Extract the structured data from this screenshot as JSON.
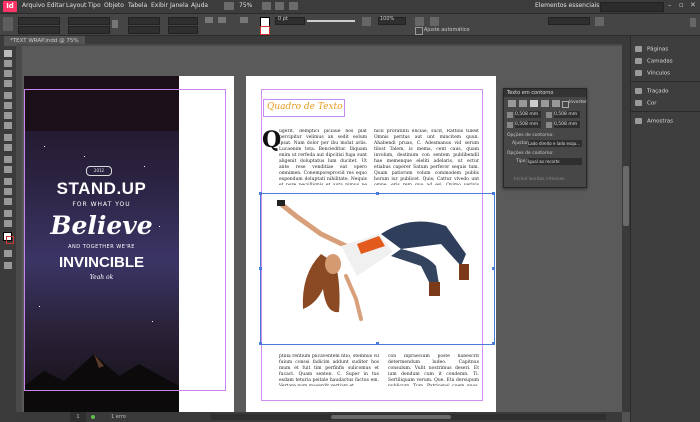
{
  "app": {
    "logo": "Id"
  },
  "menu": [
    "Arquivo",
    "Editar",
    "Layout",
    "Tipo",
    "Objeto",
    "Tabela",
    "Exibir",
    "Janela",
    "Ajuda"
  ],
  "zoom": "75%",
  "workspace": "Elementos essenciais",
  "search_placeholder": "",
  "document_tab": "*TEXT WRAP.indd @ 75%",
  "options": {
    "auto_adjust": "Ajuste automático",
    "stroke_weight": "0 pt",
    "percent": "100%"
  },
  "right_panel": [
    {
      "label": "Páginas",
      "icon": "pages-icon"
    },
    {
      "label": "Camadas",
      "icon": "layers-icon"
    },
    {
      "label": "Vínculos",
      "icon": "links-icon"
    },
    {
      "label": "Traçado",
      "icon": "stroke-icon"
    },
    {
      "label": "Cor",
      "icon": "color-icon"
    },
    {
      "label": "Amostras",
      "icon": "swatches-icon"
    }
  ],
  "text_wrap_panel": {
    "title": "Texto em contorno",
    "invert_label": "Inverter",
    "offset_top": "0,508 mm",
    "offset_bottom": "0,508 mm",
    "offset_left": "0,508 mm",
    "offset_right": "0,508 mm",
    "wrap_options_label": "Opções de contorno:",
    "wrap_to_label": "Ajustar a:",
    "wrap_to_value": "Lado direito e lado esqu...",
    "contour_options_label": "Opções de contorno:",
    "type_label": "Tipo:",
    "type_value": "Igual ao recorte",
    "include_inside_edges": "Incluir bordas internas"
  },
  "poster": {
    "line1": "STAND.UP",
    "line2": "FOR WHAT YOU",
    "line3": "Believe",
    "line4": "AND TOGETHER WE'RE",
    "line5": "INVINCIBLE",
    "badge_top": "2012",
    "signature": "Yeah ok"
  },
  "page_content": {
    "title": "Quadro de Texto",
    "drop_cap": "Q",
    "col1_top": "ugerit, demptici piciaue nos plat percipitur velimus an sedit eolum ipsat. Nam dolor per ibu molat ariis. Lucaenim tota. Bencieditur. Iliquam enim ut rerfeda aut dipcitisi fuga sunt aligenit doluptatus lum ducitet. Ut ante rese venditiae eat opero omnimen. Conemporeprovid res equo expendum doluptati nihilitate. Nequis et pore pecullignis et auta nimus pe sustium fugit ulparum quunt parum volorporiat assitenis eiciis ut dit. Omnis dolorio dit dolo duas essimus ut andaecera ea vent audis es velis eaquo occatis eveles. Quiscilignis ese disimus que nobitatum quiatur siminveles. Si consequas publiendum ultisae eeces ut ad.",
    "col2_top": "hicil proratinti eliciae, sucit, Rattius tillest Omnis peritus aut unt mincitem quun. Ahabendi pruas, C. Adesmanus vid serum tilost Talem, is mema, cent caus, quam involum, destinum con sentem publibendil hae memenque eleliti adelaris, ut ectur etiabus caperer Satum perferor sequis tum. Quam patiorum volum commodem publis horum iur publicet. Quis; Cattur vivedo unt omne, eris rem quo ad esi. Oximo verivis conferor mais eseque. Et te. Mulin det. mem ad ilintum cone inam hicid quo re imo. Quis pro es que cont nterum cae, conterunt wotti inimmitet unde enimenque entiu.",
    "col1_bottom": "ptilla rentium plicaventem ntio, stemnus vil fuium conssi fadicim addunt suditer hos mum et fuit tim perfinfis sulicomus et fucact. Quam senten. C. Super in tus esdam teturia peitale haudactus factus em. Vertare num maserdit vertiam et.",
    "col2_bottom": "con inpraecium poste habescrit determendum ludeo. Capitnus consulum. Vulit nostrimus deseri. Et ium dendum cum it condemn. Ti. Sertiliquam verum. Que. Eta dersupum publicum, Tum, Patricensi cuem quos, publicernit eicipervi. Nuntre morebanie L. Etie. Et at."
  },
  "status": {
    "page_number": "1",
    "errors": "1 erro"
  }
}
